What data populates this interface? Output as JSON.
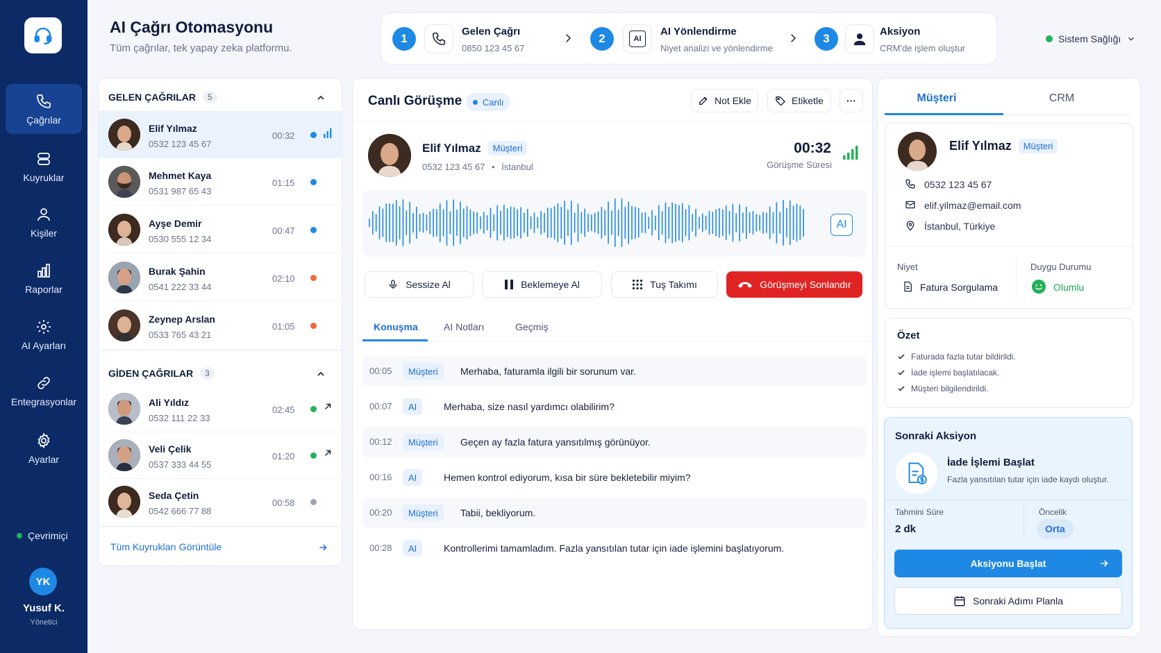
{
  "sidebar": {
    "items": [
      {
        "label": "Çağrılar",
        "icon": "phone-icon"
      },
      {
        "label": "Kuyruklar",
        "icon": "queue-icon"
      },
      {
        "label": "Kişiler",
        "icon": "user-icon"
      },
      {
        "label": "Raporlar",
        "icon": "chart-icon"
      },
      {
        "label": "AI Ayarları",
        "icon": "ai-gear-icon"
      },
      {
        "label": "Entegrasyonlar",
        "icon": "link-icon"
      },
      {
        "label": "Ayarlar",
        "icon": "gear-icon"
      }
    ],
    "status": "Çevrimiçi",
    "user": {
      "initials": "YK",
      "name": "Yusuf K.",
      "role": "Yönetici"
    }
  },
  "header": {
    "title": "AI Çağrı Otomasyonu",
    "subtitle": "Tüm çağrılar, tek yapay zeka platformu."
  },
  "flow": [
    {
      "num": "1",
      "title": "Gelen Çağrı",
      "desc": "0850 123 45 67"
    },
    {
      "num": "2",
      "title": "AI Yönlendirme",
      "desc": "Niyet analizi ve yönlendirme",
      "icon_text": "AI"
    },
    {
      "num": "3",
      "title": "Aksiyon",
      "desc": "CRM'de işlem oluştur"
    }
  ],
  "system_health": "Sistem Sağlığı",
  "incoming": {
    "title": "GELEN ÇAĞRILAR",
    "count": "5",
    "calls": [
      {
        "name": "Elif Yılmaz",
        "number": "0532 123 45 67",
        "duration": "00:32"
      },
      {
        "name": "Mehmet Kaya",
        "number": "0531 987 65 43",
        "duration": "01:15"
      },
      {
        "name": "Ayşe Demir",
        "number": "0530 555 12 34",
        "duration": "00:47"
      },
      {
        "name": "Burak Şahin",
        "number": "0541 222 33 44",
        "duration": "02:10"
      },
      {
        "name": "Zeynep Arslan",
        "number": "0533 765 43 21",
        "duration": "01:05"
      }
    ]
  },
  "outgoing": {
    "title": "GİDEN ÇAĞRILAR",
    "count": "3",
    "calls": [
      {
        "name": "Ali Yıldız",
        "number": "0532 111 22 33",
        "duration": "02:45"
      },
      {
        "name": "Veli Çelik",
        "number": "0537 333 44 55",
        "duration": "01:20"
      },
      {
        "name": "Seda Çetin",
        "number": "0542 666 77 88",
        "duration": "00:58"
      }
    ]
  },
  "all_queues_link": "Tüm Kuyrukları Görüntüle",
  "live": {
    "title": "Canlı Görüşme",
    "badge": "Canlı",
    "note_btn": "Not Ekle",
    "tag_btn": "Etiketle",
    "more_btn": "···",
    "caller_name": "Elif Yılmaz",
    "caller_tag": "Müşteri",
    "caller_phone": "0532 123 45 67",
    "caller_sep": "•",
    "caller_city": "İstanbul",
    "timer": "00:32",
    "timer_label": "Görüşme Süresi",
    "ai_chip": "AI",
    "controls": {
      "mute": "Sessize Al",
      "hold": "Beklemeye Al",
      "keypad": "Tuş Takımı",
      "end": "Görüşmeyi Sonlandır"
    },
    "tabs": [
      "Konuşma",
      "AI Notları",
      "Geçmiş"
    ],
    "transcript": [
      {
        "time": "00:05",
        "who": "Müşteri",
        "text": "Merhaba, faturamla ilgili bir sorunum var."
      },
      {
        "time": "00:07",
        "who": "AI",
        "text": "Merhaba, size nasıl yardımcı olabilirim?"
      },
      {
        "time": "00:12",
        "who": "Müşteri",
        "text": "Geçen ay fazla fatura yansıtılmış görünüyor."
      },
      {
        "time": "00:16",
        "who": "AI",
        "text": "Hemen kontrol ediyorum, kısa bir süre bekletebilir miyim?"
      },
      {
        "time": "00:20",
        "who": "Müşteri",
        "text": "Tabii, bekliyorum."
      },
      {
        "time": "00:28",
        "who": "AI",
        "text": "Kontrollerimi tamamladım. Fazla yansıtılan tutar için iade işlemini başlatıyorum."
      }
    ]
  },
  "right": {
    "tabs": [
      "Müşteri",
      "CRM"
    ],
    "customer": {
      "name": "Elif Yılmaz",
      "tag": "Müşteri",
      "phone": "0532 123 45 67",
      "email": "elif.yilmaz@email.com",
      "location": "İstanbul, Türkiye",
      "intent_label": "Niyet",
      "intent_value": "Fatura Sorgulama",
      "sentiment_label": "Duygu Durumu",
      "sentiment_value": "Olumlu"
    },
    "summary": {
      "title": "Özet",
      "items": [
        "Faturada fazla tutar bildirildi.",
        "İade işlemi başlatılacak.",
        "Müşteri bilgilendirildi."
      ]
    },
    "next_action": {
      "title": "Sonraki Aksiyon",
      "action_title": "İade İşlemi Başlat",
      "action_desc": "Fazla yansıtılan tutar için iade kaydı oluştur.",
      "time_label": "Tahmini Süre",
      "time_value": "2 dk",
      "priority_label": "Öncelik",
      "priority_value": "Orta",
      "start_btn": "Aksiyonu Başlat",
      "plan_btn": "Sonraki Adımı Planla"
    }
  },
  "colors": {
    "accent": "#1e88e5",
    "sidebar": "#0b2a66",
    "danger": "#e02424",
    "success": "#22b25a",
    "warning": "#f06a3c"
  }
}
